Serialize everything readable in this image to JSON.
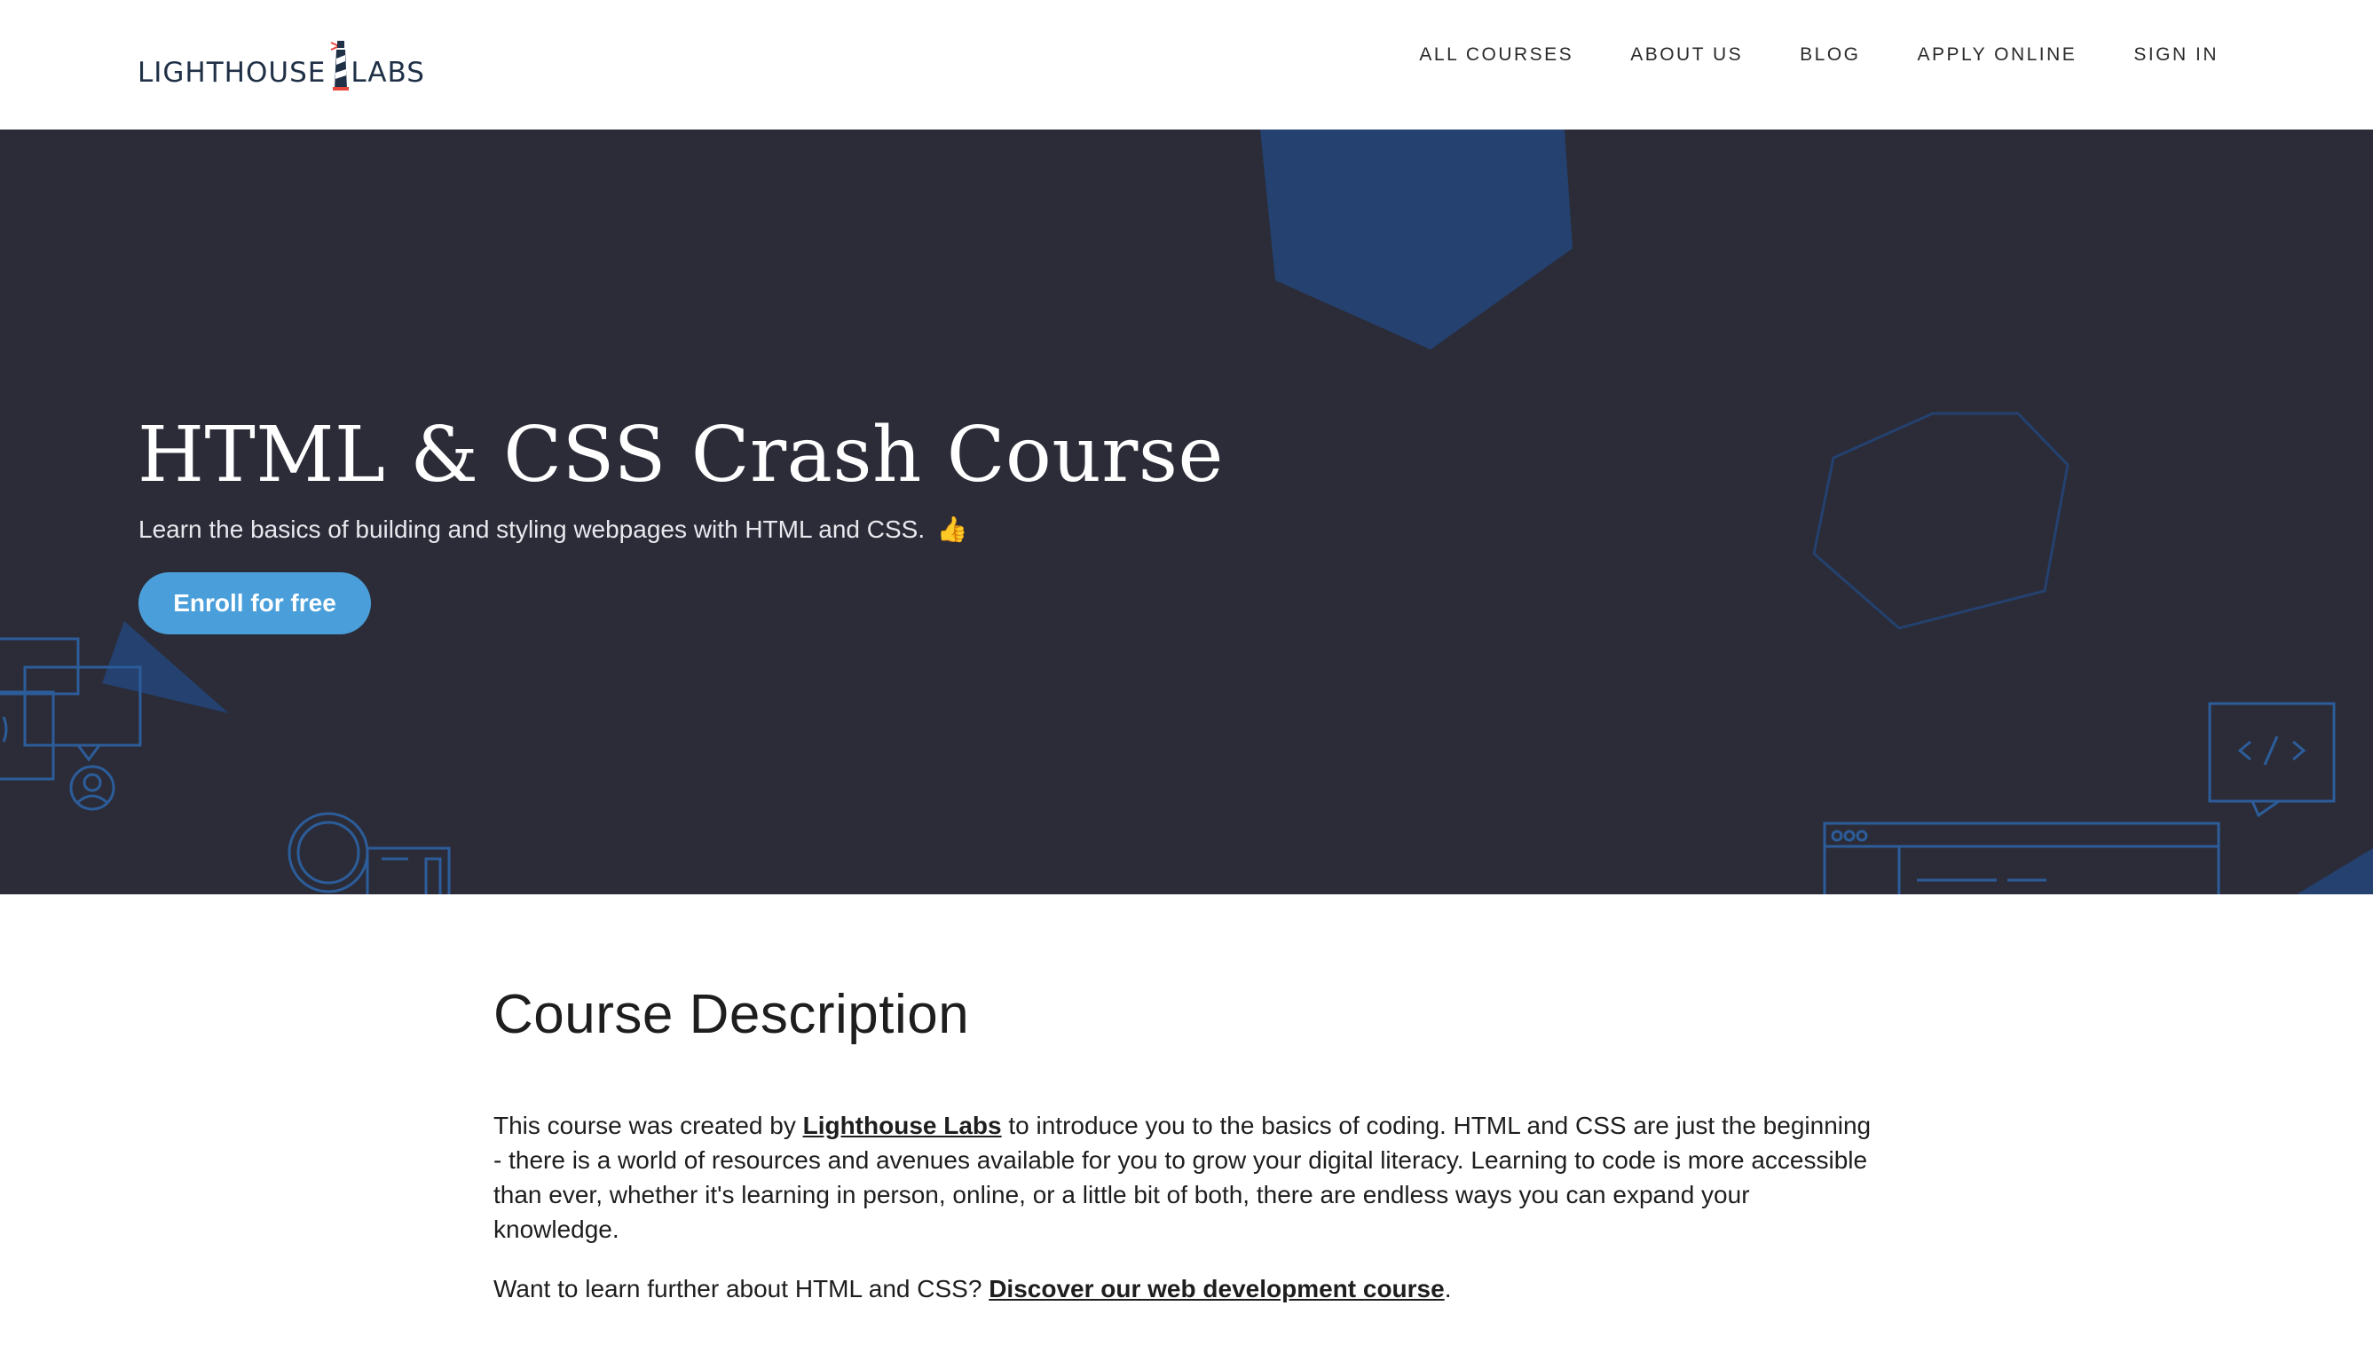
{
  "logo": {
    "left": "LIGHTHOUSE",
    "right": "LABS",
    "icon": "lighthouse-icon"
  },
  "nav": {
    "items": [
      {
        "label": "ALL COURSES"
      },
      {
        "label": "ABOUT US"
      },
      {
        "label": "BLOG"
      },
      {
        "label": "APPLY ONLINE"
      },
      {
        "label": "SIGN IN"
      }
    ]
  },
  "hero": {
    "title": "HTML & CSS Crash Course",
    "subtitle": "Learn the basics of building and styling webpages with HTML and CSS.",
    "emoji": "👍",
    "cta_label": "Enroll for free",
    "background_color": "#2b2c38",
    "accent_color": "#4a9fda",
    "shape_color": "#24416f"
  },
  "description": {
    "heading": "Course Description",
    "p1_before": "This course was created by ",
    "p1_link": "Lighthouse Labs",
    "p1_after": " to introduce you to the basics of coding. HTML and CSS are just the beginning - there is a world of resources and avenues available for you to grow your digital literacy. Learning to code is more accessible than ever, whether it's learning in person, online, or a little bit of both, there are endless ways you can expand your knowledge.",
    "p2_before": "Want to learn further about HTML and CSS? ",
    "p2_link": "Discover our web development course",
    "p2_after": "."
  }
}
